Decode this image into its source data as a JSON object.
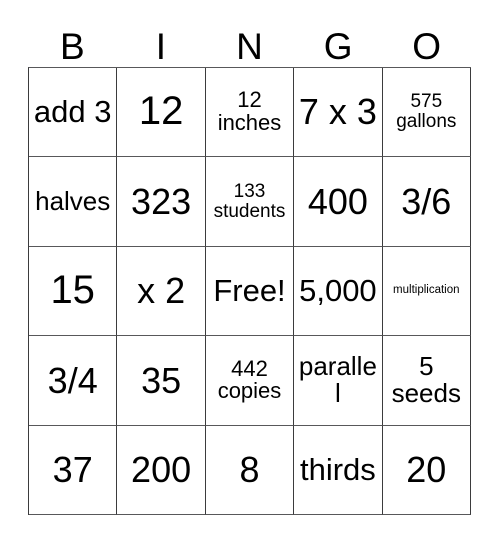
{
  "card": {
    "type": "bingo-card",
    "columns": 5,
    "rows": 5,
    "header_letters": [
      "B",
      "I",
      "N",
      "G",
      "O"
    ],
    "free_space": {
      "row": 3,
      "column": 3,
      "label": "Free!"
    },
    "colors": {
      "background": "#ffffff",
      "text": "#000000",
      "grid_line": "#3b3b3d"
    },
    "cells": [
      [
        {
          "text": "add 3",
          "size": "fs-md"
        },
        {
          "text": "12",
          "size": "fs-xl"
        },
        {
          "text": "12 inches",
          "size": "fs-xs"
        },
        {
          "text": "7 x 3",
          "size": "fs-lg"
        },
        {
          "text": "575 gallons",
          "size": "fs-xxs"
        }
      ],
      [
        {
          "text": "halves",
          "size": "fs-sm"
        },
        {
          "text": "323",
          "size": "fs-lg"
        },
        {
          "text": "133 students",
          "size": "fs-xxs"
        },
        {
          "text": "400",
          "size": "fs-lg"
        },
        {
          "text": "3/6",
          "size": "fs-lg"
        }
      ],
      [
        {
          "text": "15",
          "size": "fs-xl"
        },
        {
          "text": "x 2",
          "size": "fs-lg"
        },
        {
          "text": "Free!",
          "size": "fs-md"
        },
        {
          "text": "5,000",
          "size": "fs-md"
        },
        {
          "text": "multiplication",
          "size": "fs-tiny"
        }
      ],
      [
        {
          "text": "3/4",
          "size": "fs-lg"
        },
        {
          "text": "35",
          "size": "fs-lg"
        },
        {
          "text": "442 copies",
          "size": "fs-xs"
        },
        {
          "text": "parallel",
          "size": "fs-sm"
        },
        {
          "text": "5 seeds",
          "size": "fs-sm"
        }
      ],
      [
        {
          "text": "37",
          "size": "fs-lg"
        },
        {
          "text": "200",
          "size": "fs-lg"
        },
        {
          "text": "8",
          "size": "fs-lg"
        },
        {
          "text": "thirds",
          "size": "fs-md"
        },
        {
          "text": "20",
          "size": "fs-lg"
        }
      ]
    ]
  }
}
